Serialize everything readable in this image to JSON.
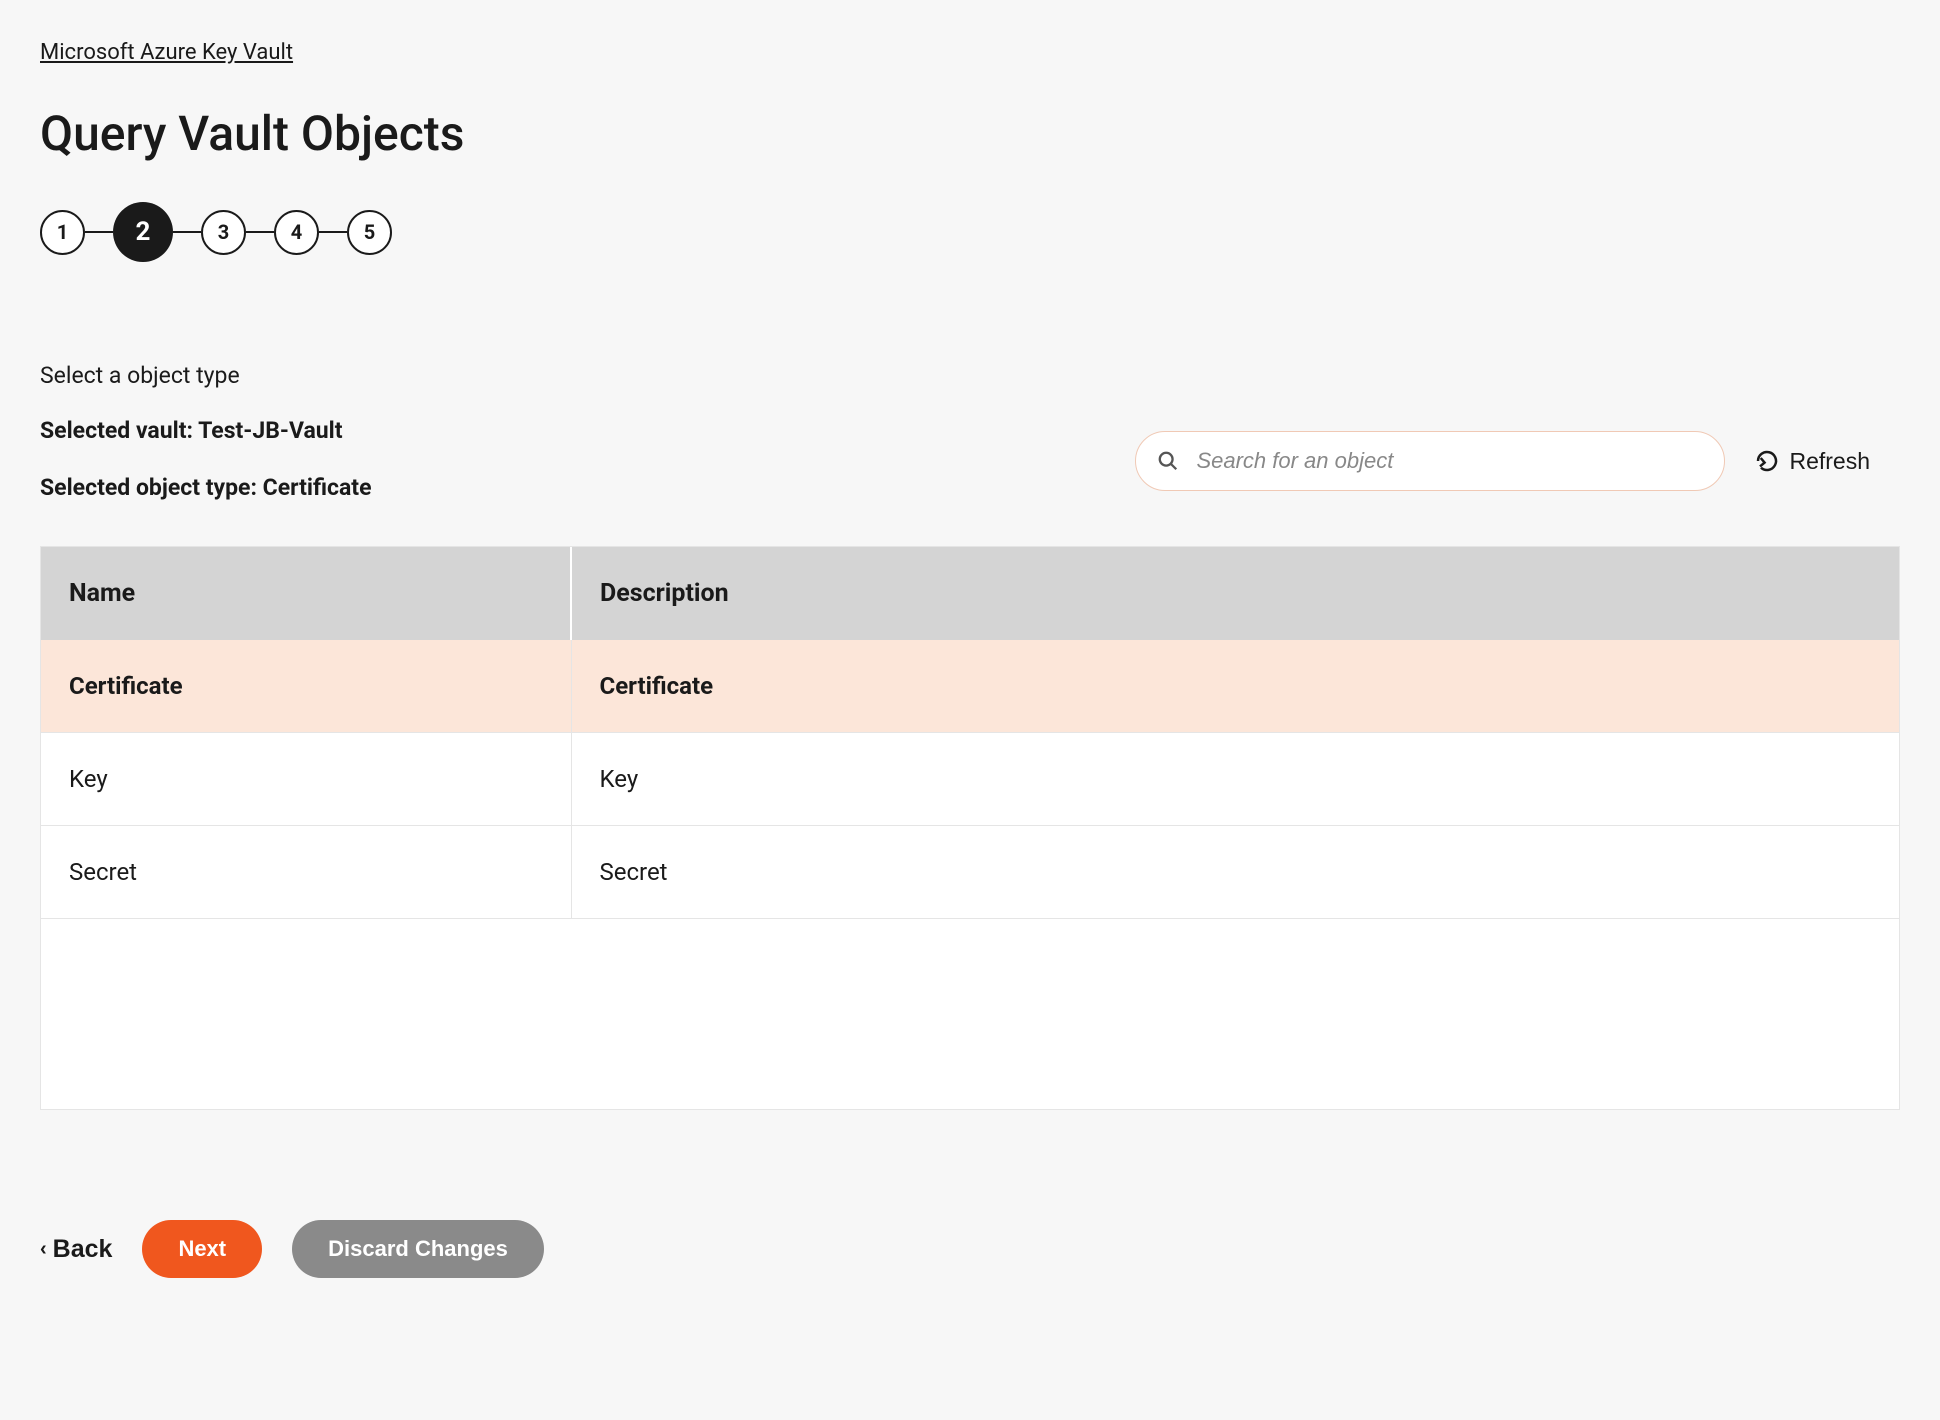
{
  "breadcrumb": "Microsoft Azure Key Vault",
  "title": "Query Vault Objects",
  "stepper": {
    "steps": [
      "1",
      "2",
      "3",
      "4",
      "5"
    ],
    "active": 2
  },
  "info": {
    "instruction": "Select a object type",
    "selected_vault": "Selected vault: Test-JB-Vault",
    "selected_type": "Selected object type: Certificate"
  },
  "search": {
    "placeholder": "Search for an object"
  },
  "refresh_label": "Refresh",
  "table": {
    "headers": {
      "name": "Name",
      "description": "Description"
    },
    "rows": [
      {
        "name": "Certificate",
        "description": "Certificate",
        "selected": true
      },
      {
        "name": "Key",
        "description": "Key",
        "selected": false
      },
      {
        "name": "Secret",
        "description": "Secret",
        "selected": false
      }
    ]
  },
  "buttons": {
    "back": "Back",
    "next": "Next",
    "discard": "Discard Changes"
  }
}
